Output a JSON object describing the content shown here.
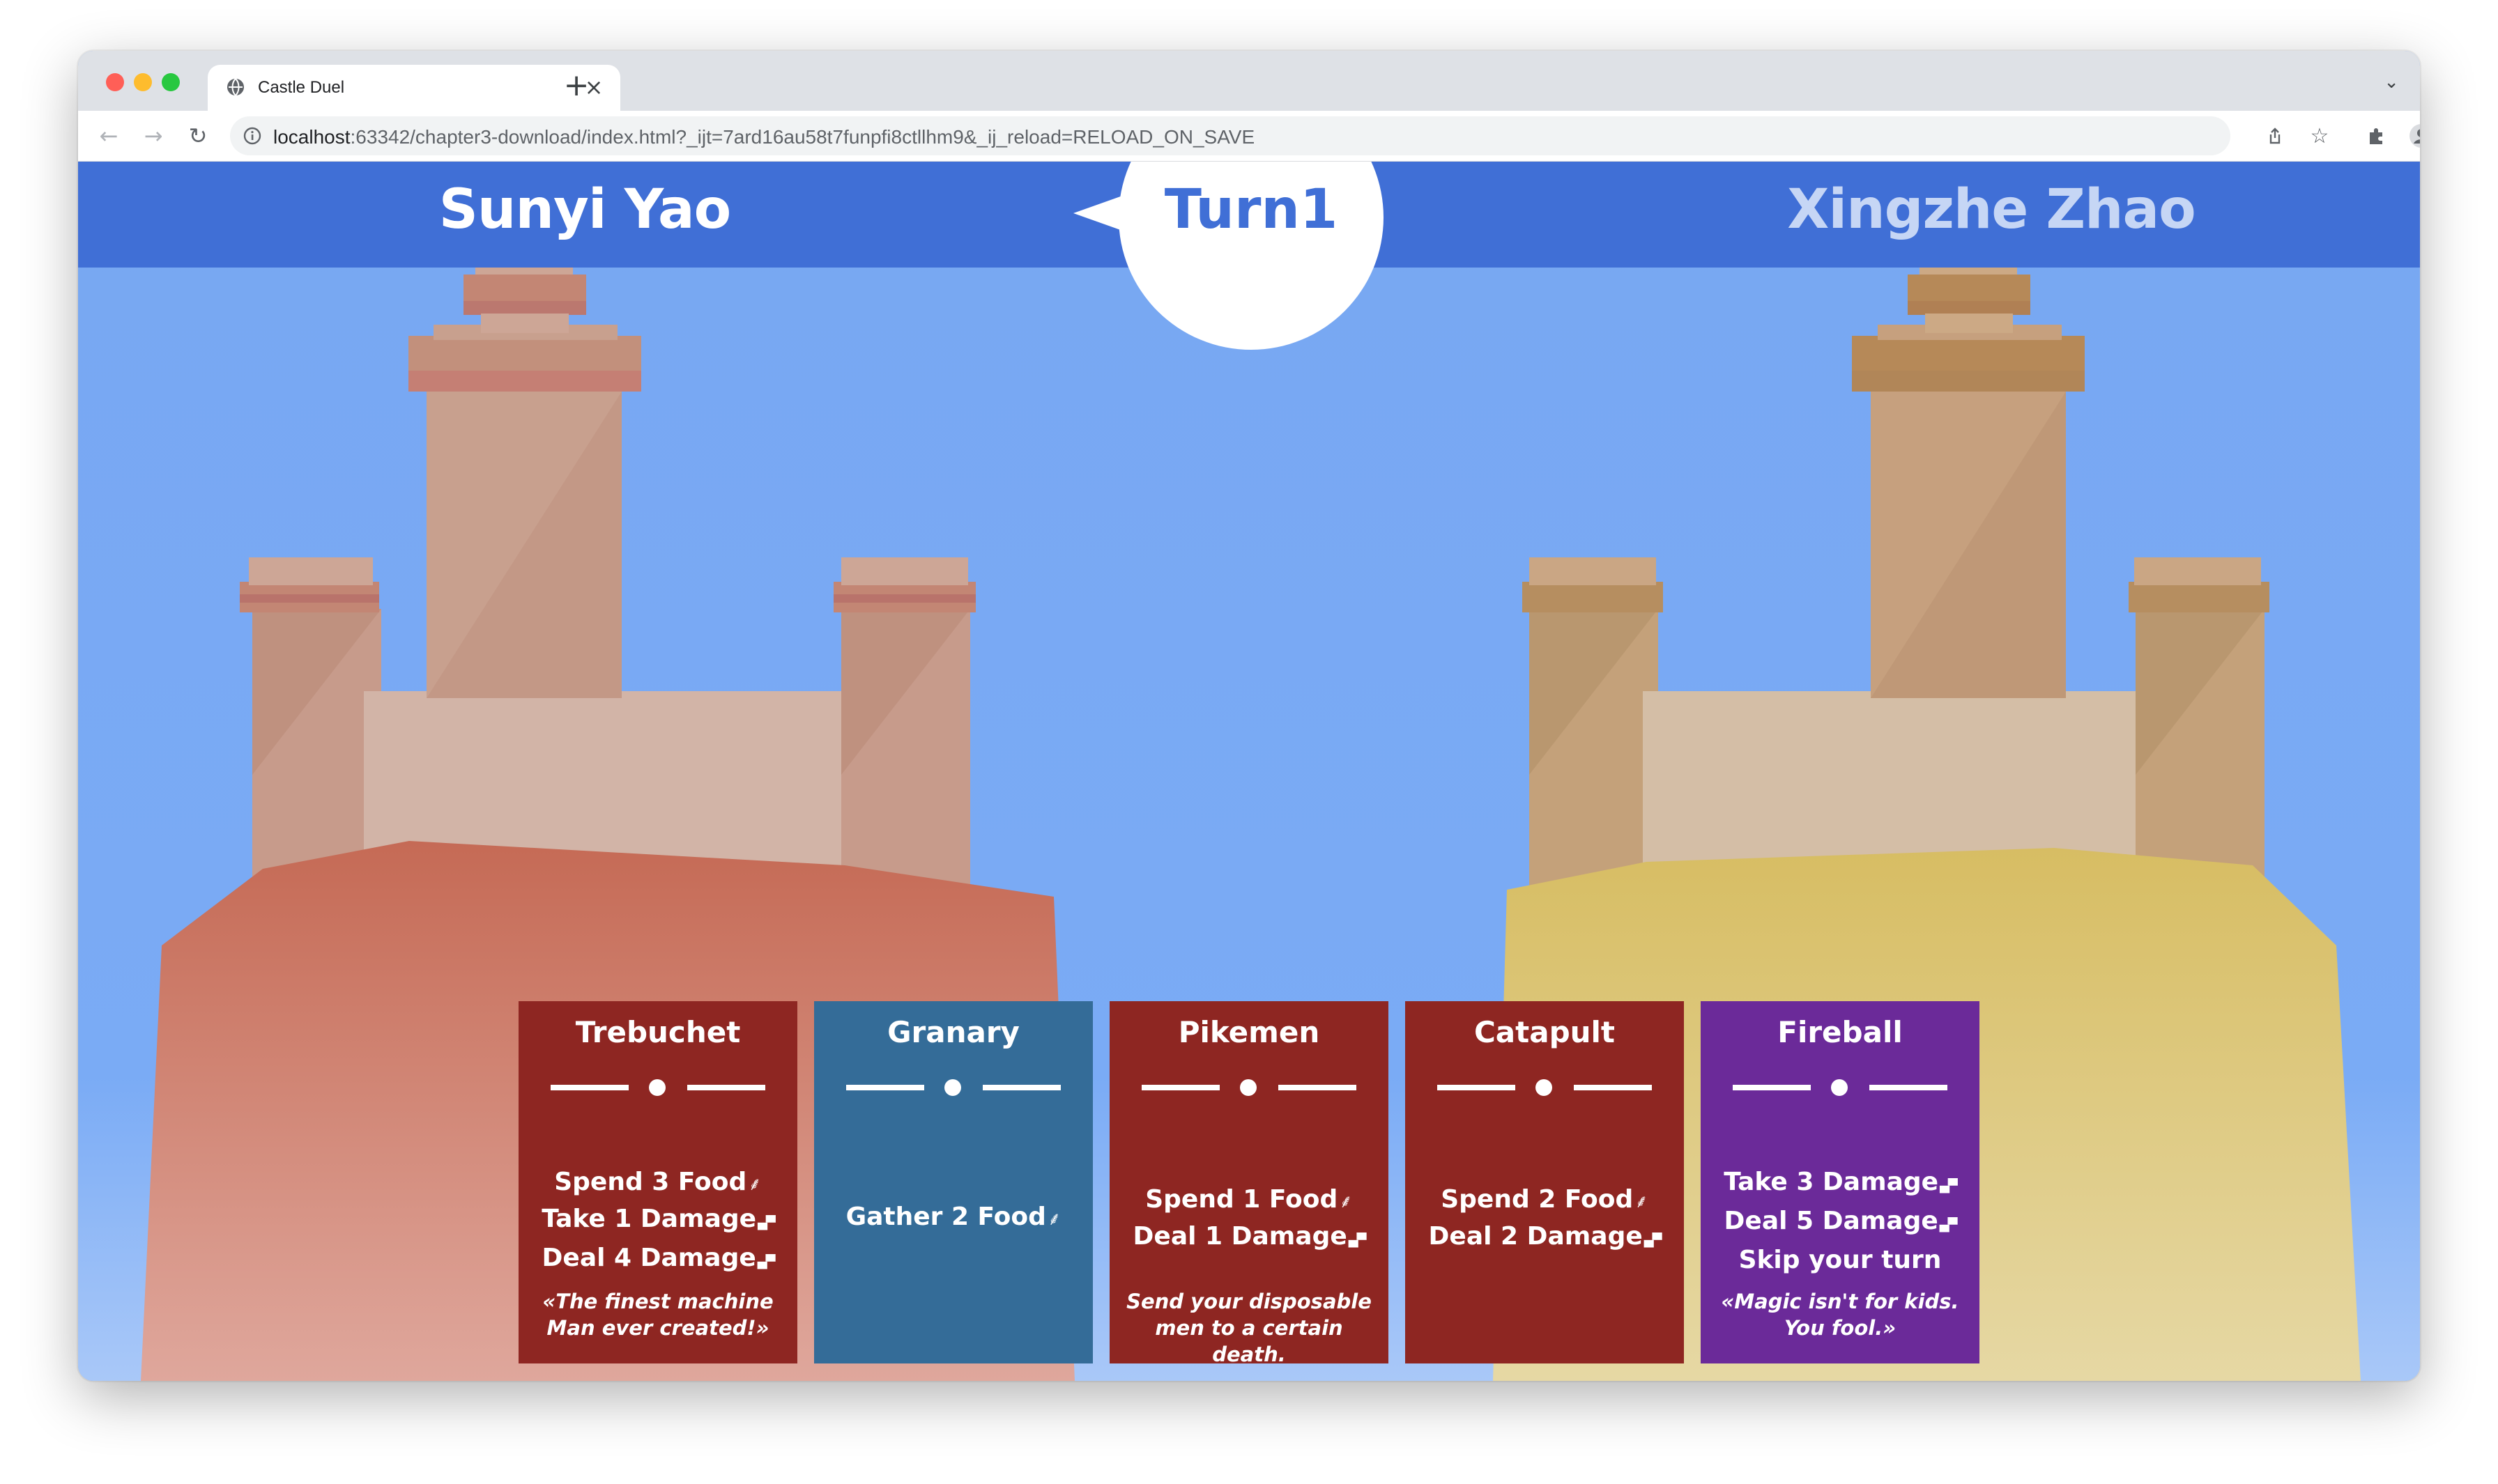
{
  "browser": {
    "tab_title": "Castle Duel",
    "url_host": "localhost",
    "url_rest": ":63342/chapter3-download/index.html?_ijt=7ard16au58t7funpfi8ctllhm9&_ij_reload=RELOAD_ON_SAVE",
    "new_tab_label": "+",
    "close_tab_label": "×"
  },
  "game": {
    "player1_name": "Sunyi Yao",
    "player2_name": "Xingzhe Zhao",
    "turn_label": "Turn1",
    "colors": {
      "header": "#406fd6",
      "sky": "#78a7f2",
      "player1_name": "#ffffff",
      "player2_name": "#c6d6f5",
      "card_attack": "#8e2622",
      "card_resource": "#346c98",
      "card_magic": "#6b2a99"
    },
    "cards": [
      {
        "title": "Trebuchet",
        "type": "attack",
        "lines": [
          {
            "text": "Spend 3 Food",
            "icon": "wheat-icon"
          },
          {
            "text": "Take 1 Damage",
            "icon": "brick-icon"
          },
          {
            "text": "Deal 4 Damage",
            "icon": "brick-icon"
          }
        ],
        "flavor": "«The finest machine Man ever created!»"
      },
      {
        "title": "Granary",
        "type": "resource",
        "lines": [
          {
            "text": "Gather 2 Food",
            "icon": "wheat-icon"
          }
        ],
        "flavor": ""
      },
      {
        "title": "Pikemen",
        "type": "attack",
        "lines": [
          {
            "text": "Spend 1 Food",
            "icon": "wheat-icon"
          },
          {
            "text": "Deal 1 Damage",
            "icon": "brick-icon"
          }
        ],
        "flavor": "Send your disposable men to a certain death."
      },
      {
        "title": "Catapult",
        "type": "attack",
        "lines": [
          {
            "text": "Spend 2 Food",
            "icon": "wheat-icon"
          },
          {
            "text": "Deal 2 Damage",
            "icon": "brick-icon"
          }
        ],
        "flavor": ""
      },
      {
        "title": "Fireball",
        "type": "magic",
        "lines": [
          {
            "text": "Take 3 Damage",
            "icon": "brick-icon"
          },
          {
            "text": "Deal 5 Damage",
            "icon": "brick-icon"
          },
          {
            "text": "Skip your turn",
            "icon": ""
          }
        ],
        "flavor": "«Magic isn't for kids. You fool.»"
      }
    ]
  }
}
